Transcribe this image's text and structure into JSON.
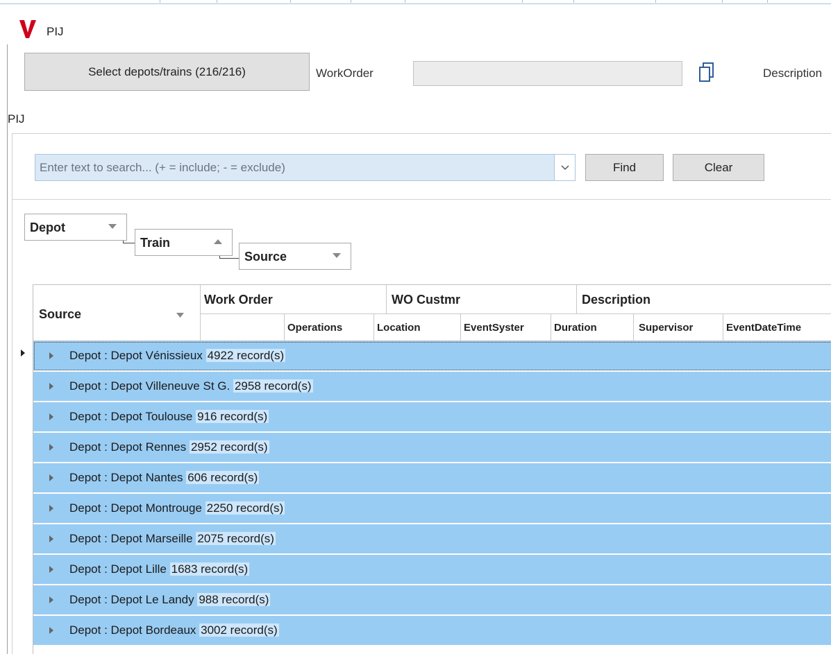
{
  "app": {
    "title": "PIJ",
    "brand_color": "#d0021b"
  },
  "toolbar": {
    "select_label": "Select depots/trains (216/216)",
    "workorder_label": "WorkOrder",
    "workorder_value": "",
    "description_label": "Description",
    "section_label": "PIJ"
  },
  "search": {
    "placeholder": "Enter text to search... (+ = include; - = exclude)",
    "find_label": "Find",
    "clear_label": "Clear"
  },
  "grouping": {
    "items": [
      {
        "label": "Depot",
        "sort": "desc"
      },
      {
        "label": "Train",
        "sort": "asc"
      },
      {
        "label": "Source",
        "sort": "desc"
      }
    ]
  },
  "grid": {
    "header_top": [
      "Source",
      "Work Order",
      "WO Custmr",
      "Description"
    ],
    "header_sub": [
      "Operations",
      "Location",
      "EventSyster",
      "Duration",
      "Supervisor",
      "EventDateTime"
    ],
    "row_color": "#99ccf3",
    "rows": [
      {
        "label": "Depot : Depot Vénissieux",
        "count": "4922 record(s)"
      },
      {
        "label": "Depot : Depot Villeneuve St G.",
        "count": "2958 record(s)"
      },
      {
        "label": "Depot : Depot Toulouse",
        "count": "916 record(s)"
      },
      {
        "label": "Depot : Depot Rennes",
        "count": "2952 record(s)"
      },
      {
        "label": "Depot : Depot Nantes",
        "count": "606 record(s)"
      },
      {
        "label": "Depot : Depot Montrouge",
        "count": "2250 record(s)"
      },
      {
        "label": "Depot : Depot Marseille",
        "count": "2075 record(s)"
      },
      {
        "label": "Depot : Depot Lille",
        "count": "1683 record(s)"
      },
      {
        "label": "Depot : Depot Le Landy",
        "count": "988 record(s)"
      },
      {
        "label": "Depot : Depot Bordeaux",
        "count": "3002 record(s)"
      }
    ]
  }
}
